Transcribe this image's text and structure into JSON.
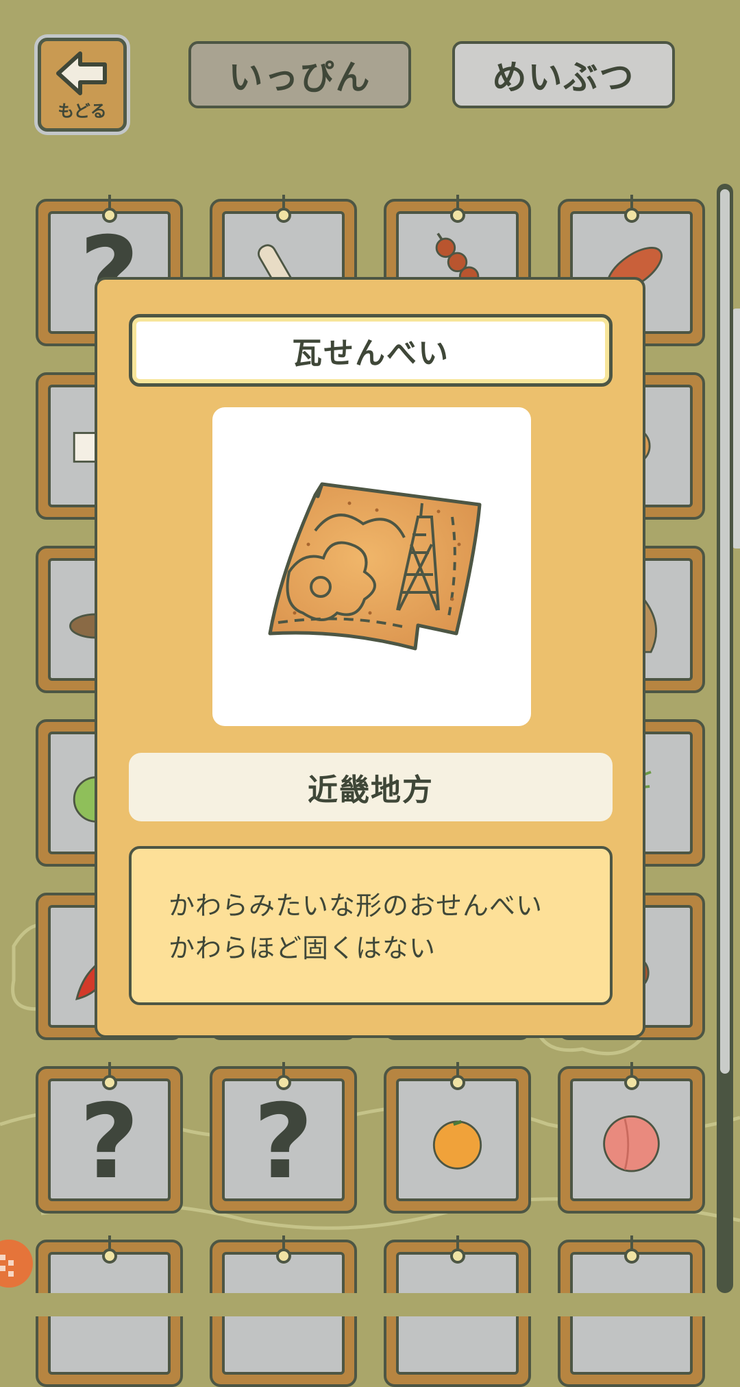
{
  "header": {
    "back_label": "もどる",
    "tab_food_label": "いっぴん",
    "tab_specialty_label": "めいぶつ",
    "active_tab": "いっぴん"
  },
  "item_detail": {
    "name": "瓦せんべい",
    "region": "近畿地方",
    "description_line1": "かわらみたいな形のおせんべい",
    "description_line2": "かわらほど固くはない",
    "image_icon": "kawara-senbei-icon"
  },
  "grid": {
    "unknown_mark": "?",
    "items": [
      {
        "icon": "unknown"
      },
      {
        "icon": "chikuwa-icon"
      },
      {
        "icon": "dango-icon"
      },
      {
        "icon": "sausage-bread-icon"
      },
      {
        "icon": "tofu-icon"
      },
      {
        "icon": "hidden"
      },
      {
        "icon": "hidden"
      },
      {
        "icon": "bun-icon"
      },
      {
        "icon": "mushroom-icon"
      },
      {
        "icon": "hidden"
      },
      {
        "icon": "hidden"
      },
      {
        "icon": "sack-icon"
      },
      {
        "icon": "cabbage-icon"
      },
      {
        "icon": "hidden"
      },
      {
        "icon": "hidden"
      },
      {
        "icon": "leek-icon"
      },
      {
        "icon": "chili-icon"
      },
      {
        "icon": "hidden"
      },
      {
        "icon": "hidden"
      },
      {
        "icon": "chestnut-icon"
      },
      {
        "icon": "unknown"
      },
      {
        "icon": "unknown"
      },
      {
        "icon": "mikan-icon"
      },
      {
        "icon": "peach-icon"
      }
    ]
  },
  "colors": {
    "background": "#aaa66a",
    "modal": "#ecc06d",
    "card_frame": "#b78541",
    "outline": "#4d5644"
  }
}
